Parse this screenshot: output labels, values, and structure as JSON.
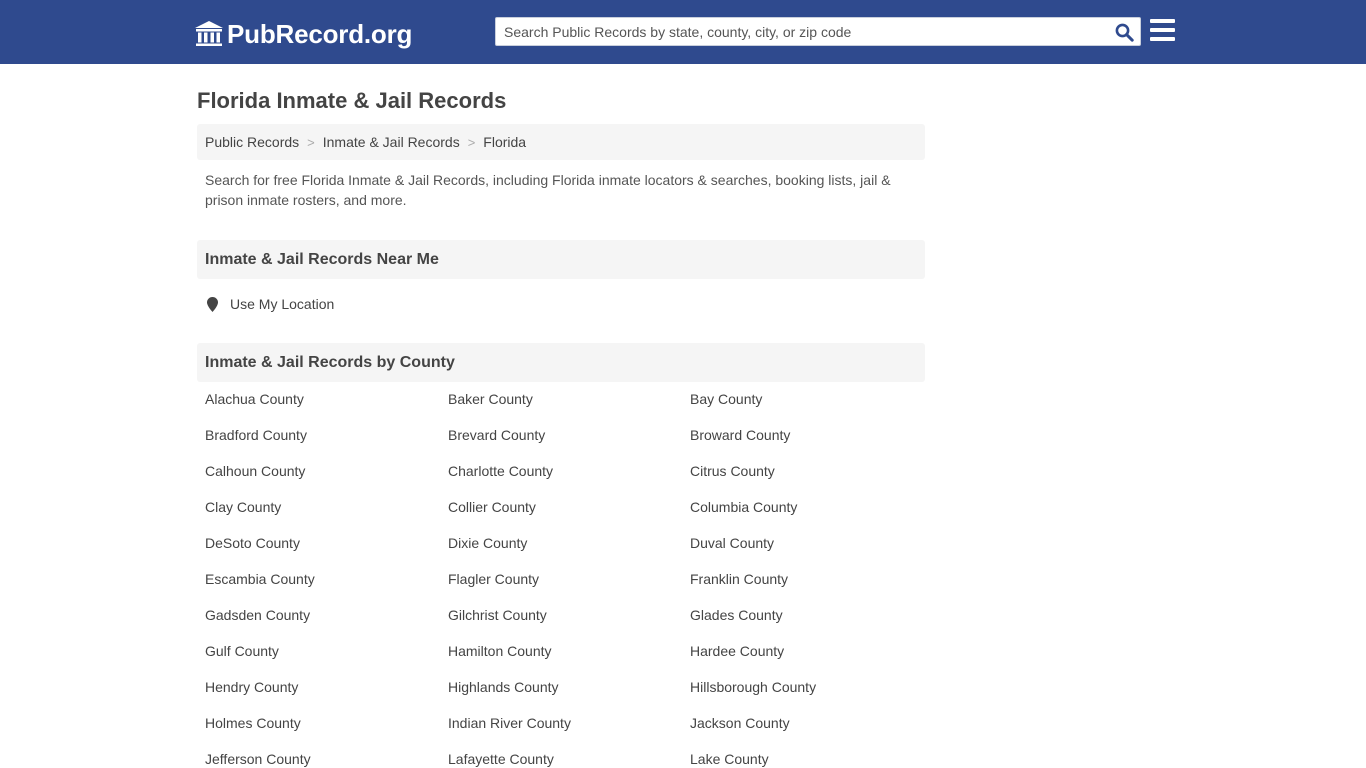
{
  "header": {
    "logo_text": "PubRecord.org",
    "search_placeholder": "Search Public Records by state, county, city, or zip code",
    "brand_color": "#2f4a8e"
  },
  "page": {
    "title": "Florida Inmate & Jail Records",
    "intro": "Search for free Florida Inmate & Jail Records, including Florida inmate locators & searches, booking lists, jail & prison inmate rosters, and more."
  },
  "breadcrumb": {
    "items": [
      "Public Records",
      "Inmate & Jail Records",
      "Florida"
    ],
    "separator": ">"
  },
  "near_me": {
    "heading": "Inmate & Jail Records Near Me",
    "location_label": "Use My Location"
  },
  "counties": {
    "heading": "Inmate & Jail Records by County",
    "items": [
      "Alachua County",
      "Baker County",
      "Bay County",
      "Bradford County",
      "Brevard County",
      "Broward County",
      "Calhoun County",
      "Charlotte County",
      "Citrus County",
      "Clay County",
      "Collier County",
      "Columbia County",
      "DeSoto County",
      "Dixie County",
      "Duval County",
      "Escambia County",
      "Flagler County",
      "Franklin County",
      "Gadsden County",
      "Gilchrist County",
      "Glades County",
      "Gulf County",
      "Hamilton County",
      "Hardee County",
      "Hendry County",
      "Highlands County",
      "Hillsborough County",
      "Holmes County",
      "Indian River County",
      "Jackson County",
      "Jefferson County",
      "Lafayette County",
      "Lake County"
    ]
  },
  "icons": {
    "logo": "courthouse-icon",
    "search": "search-icon",
    "menu": "hamburger-menu-icon",
    "location": "map-pin-icon"
  }
}
